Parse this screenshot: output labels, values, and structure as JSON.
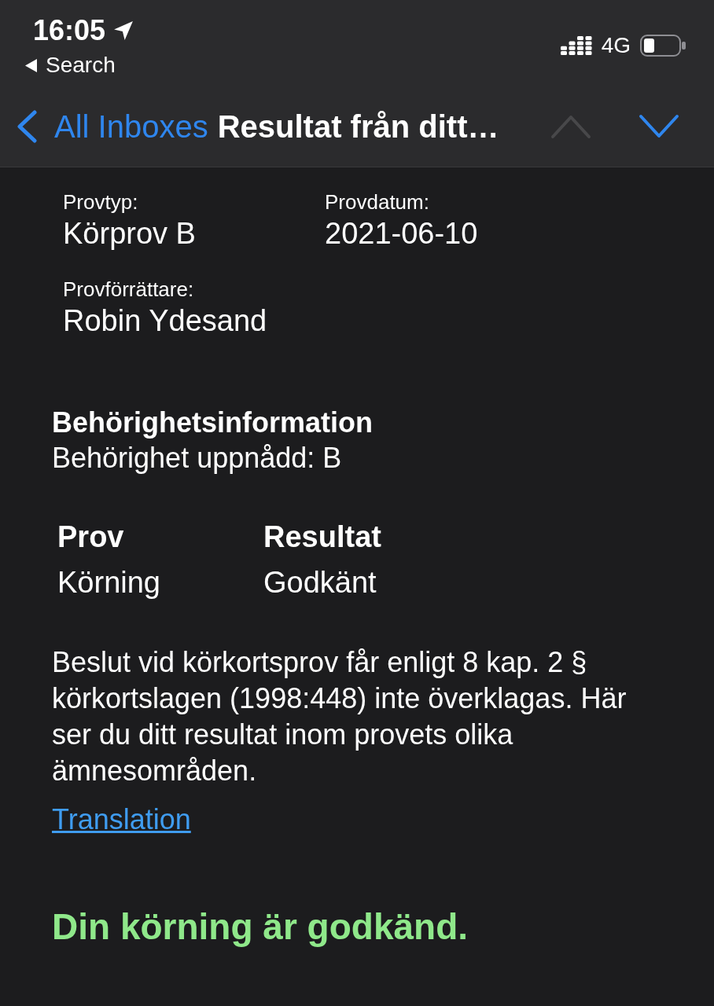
{
  "status_bar": {
    "time": "16:05",
    "back_app": "Search",
    "network": "4G"
  },
  "nav": {
    "back_label": "All Inboxes",
    "title": "Resultat från ditt…",
    "arrows": [
      {
        "kind": "previous",
        "disabled": true
      },
      {
        "kind": "next",
        "disabled": false
      }
    ]
  },
  "fields": [
    {
      "label": "Provtyp:",
      "value": "Körprov B"
    },
    {
      "label": "Provdatum:",
      "value": "2021-06-10"
    },
    {
      "label": "Provförrättare:",
      "value": "Robin Ydesand"
    }
  ],
  "eligibility": {
    "heading": "Behörighetsinformation",
    "text": "Behörighet uppnådd: B"
  },
  "table": {
    "columns": [
      "Prov",
      "Resultat"
    ],
    "rows": [
      [
        "Körning",
        "Godkänt"
      ]
    ]
  },
  "paragraph": "Beslut vid körkortsprov får enligt 8 kap. 2 § körkortslagen (1998:448) inte överklagas. Här ser du ditt resultat inom provets olika ämnesområden.",
  "link": "Translation",
  "result": "Din körning är godkänd."
}
